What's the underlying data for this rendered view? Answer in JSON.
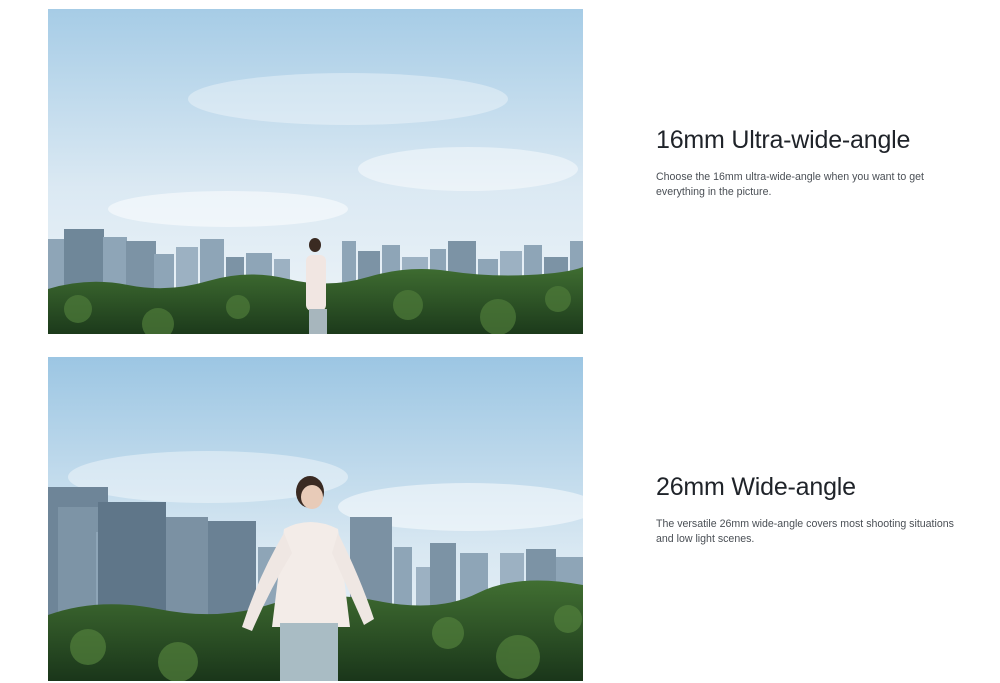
{
  "features": [
    {
      "title": "16mm Ultra-wide-angle",
      "description": "Choose the 16mm ultra-wide-angle when you want to get everything in the picture."
    },
    {
      "title": "26mm Wide-angle",
      "description": "The versatile 26mm wide-angle covers most shooting situations and low light scenes."
    }
  ],
  "colors": {
    "sky_top": "#a9cde6",
    "sky_bottom": "#eef5fa",
    "forest_dark": "#1f3d1c",
    "forest_light": "#3e6a2e",
    "building": "#8fa6b8",
    "building_dark": "#64798a"
  }
}
